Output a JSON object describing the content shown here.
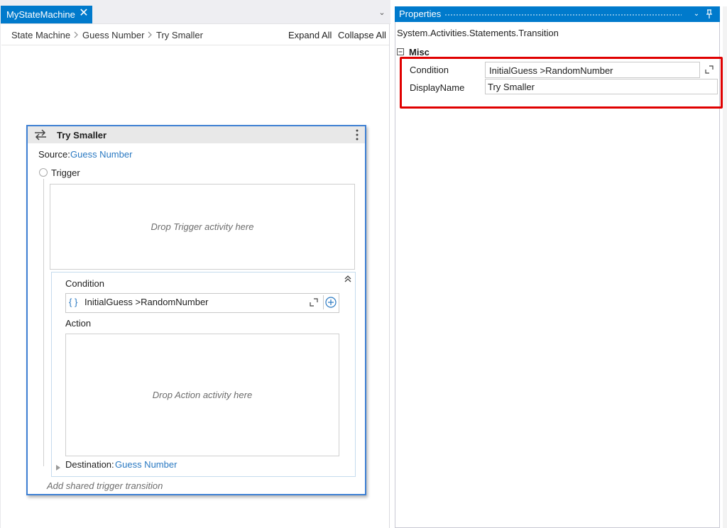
{
  "designer": {
    "tab": {
      "title": "MyStateMachine",
      "close_glyph": "✕"
    },
    "dropdown_glyph": "⌄",
    "breadcrumb": [
      "State Machine",
      "Guess Number",
      "Try Smaller"
    ],
    "expand_all": "Expand All",
    "collapse_all": "Collapse All"
  },
  "transition": {
    "title": "Try Smaller",
    "source_label": "Source:",
    "source_value": "Guess Number",
    "trigger_label": "Trigger",
    "trigger_drop": "Drop Trigger activity here",
    "condition_label": "Condition",
    "condition_braces": "{ }",
    "condition_expression": "InitialGuess >RandomNumber",
    "action_label": "Action",
    "action_drop": "Drop Action activity here",
    "destination_label": "Destination:",
    "destination_value": "Guess Number",
    "add_shared": "Add shared trigger transition"
  },
  "properties": {
    "title": "Properties",
    "type_name": "System.Activities.Statements.Transition",
    "category": "Misc",
    "rows": [
      {
        "name": "Condition",
        "value": "InitialGuess >RandomNumber"
      },
      {
        "name": "DisplayName",
        "value": "Try Smaller"
      }
    ],
    "dropdown_glyph": "⌄"
  },
  "colors": {
    "accent": "#007acc",
    "link": "#2a79c2",
    "selection_border": "#3d7fd3",
    "highlight": "#e00000"
  }
}
